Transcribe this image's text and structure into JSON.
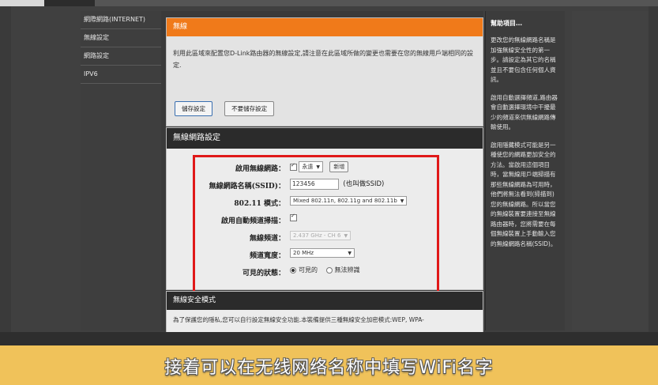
{
  "leftnav": {
    "items": [
      "網際網路(INTERNET)",
      "無線設定",
      "網路設定",
      "IPV6"
    ]
  },
  "panel_top": {
    "title": "無線",
    "description": "利用此區域來配置您D-Link路由器的無線設定,請注意在此區域所做的變更也需要在您的無線用戶端相同的設定.",
    "save_label": "儲存設定",
    "dont_save_label": "不要儲存設定"
  },
  "wireless_settings": {
    "title": "無線網路設定",
    "enable_label": "啟用無線網路：",
    "enable_value": "永遠",
    "new_button": "新增",
    "ssid_label": "無線網路名稱(SSID)：",
    "ssid_value": "123456",
    "ssid_hint": "(也叫做SSID)",
    "mode_label": "802.11 模式：",
    "mode_value": "Mixed 802.11n, 802.11g and 802.11b",
    "autochannel_label": "啟用自動頻道掃描：",
    "channel_label": "無線頻道：",
    "channel_value": "2.437 GHz - CH 6",
    "width_label": "頻道寬度：",
    "width_value": "20 MHz",
    "visibility_label": "可見的狀態：",
    "visible_option": "可見的",
    "invisible_option": "無法辨識"
  },
  "security": {
    "title": "無線安全模式",
    "description": "為了保護您的隱私,您可以自行設定無線安全功能.本裝備提供三種無線安全加密模式:WEP, WPA-"
  },
  "help": {
    "title": "幫助項目…",
    "p1": "更改您的無線網路名稱是加強無線安全性的第一步。請設定為其它的名稱並且不要包含任何個人資訊。",
    "p2": "啟用自動選擇頻道,路由器會自動選擇環境中干擾最少的頻道來供無線網路傳輸使用。",
    "p3": "啟用隱藏模式可能是另一種使您的網路更加安全的方法。當啟用這個項目時，當無線用戶端掃描有那些無線網路為可用時，他們將無法看到(掃描到)您的無線網路。所以當您的無線裝置要連接至無線路由器時，您將需要在每個無線裝置上手動輸入您的無線網路名稱(SSID)。"
  },
  "caption": {
    "text": "接着可以在无线网络名称中填写WiFi名字"
  },
  "colors": {
    "orange_header": "#f07a1a",
    "highlight_box": "#e01818",
    "caption_bg": "#f0c25a"
  }
}
